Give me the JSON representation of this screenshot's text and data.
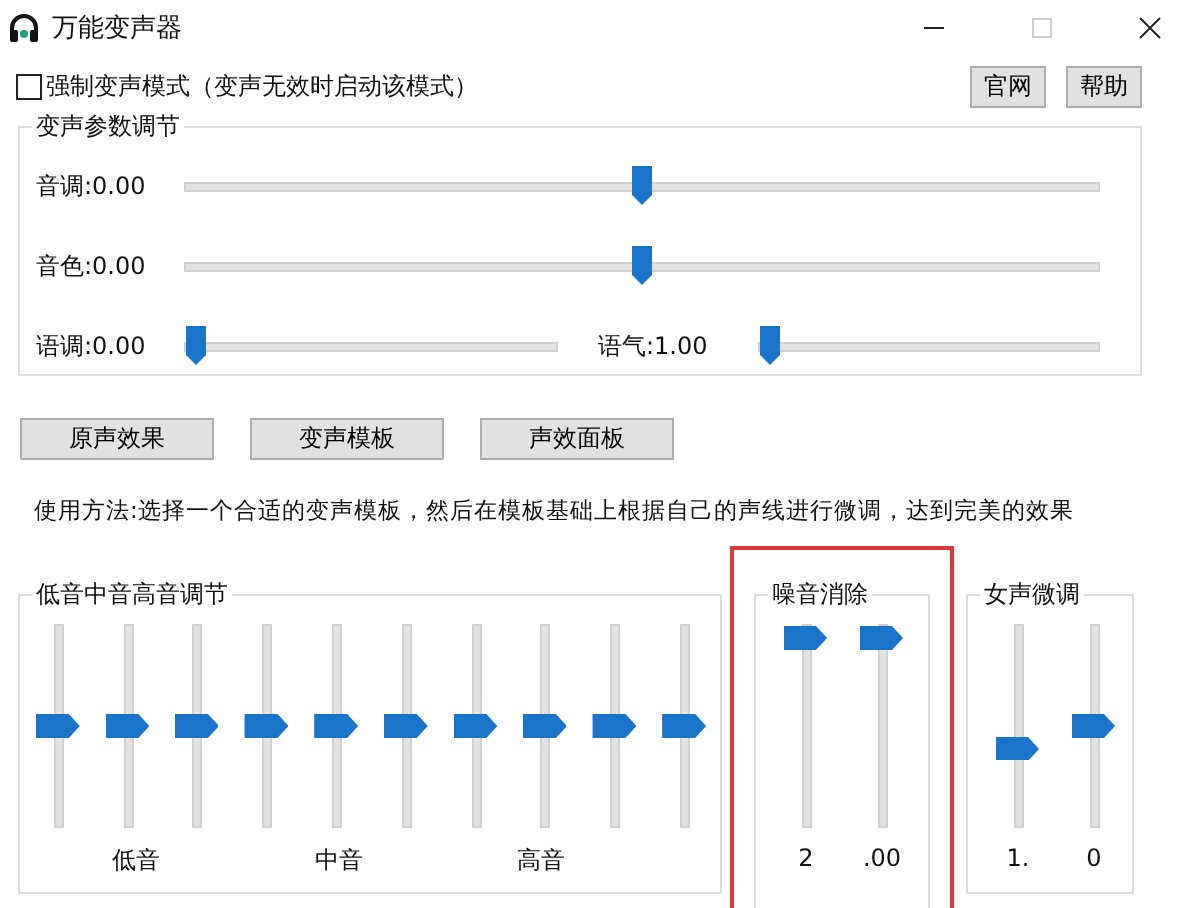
{
  "window": {
    "title": "万能变声器"
  },
  "force_mode": {
    "label": "强制变声模式（变声无效时启动该模式）",
    "checked": false
  },
  "header_buttons": [
    "官网",
    "帮助"
  ],
  "params": {
    "title": "变声参数调节",
    "sliders": [
      {
        "kind": "wide",
        "label": "音调:0.00",
        "level": 0.5
      },
      {
        "kind": "wide",
        "label": "音色:0.00",
        "level": 0.5
      },
      {
        "kind": "half",
        "label": "语调:0.00",
        "level": 0.0
      },
      {
        "kind": "half",
        "label": "语气:1.00",
        "level": 0.0
      }
    ]
  },
  "buttons": [
    "原声效果",
    "变声模板",
    "声效面板"
  ],
  "instructions": "使用方法:选择一个合适的变声模板，然后在模板基础上根据自己的声线进行微调，达到完美的效果",
  "eq": {
    "title": "低音中音高音调节",
    "sliders": [
      {
        "level": 0.5
      },
      {
        "level": 0.5
      },
      {
        "level": 0.5
      },
      {
        "level": 0.5
      },
      {
        "level": 0.5
      },
      {
        "level": 0.5
      },
      {
        "level": 0.5
      },
      {
        "level": 0.5
      },
      {
        "level": 0.5
      },
      {
        "level": 0.5
      }
    ],
    "labels": [
      "低音",
      "中音",
      "高音"
    ]
  },
  "noise": {
    "title": "噪音消除",
    "highlighted": true,
    "sliders": [
      {
        "level": 1.0,
        "reading": "2"
      },
      {
        "level": 1.0,
        "reading": ".00"
      }
    ]
  },
  "female": {
    "title": "女声微调",
    "sliders": [
      {
        "level": 0.37,
        "reading": "1."
      },
      {
        "level": 0.5,
        "reading": "0"
      }
    ]
  }
}
